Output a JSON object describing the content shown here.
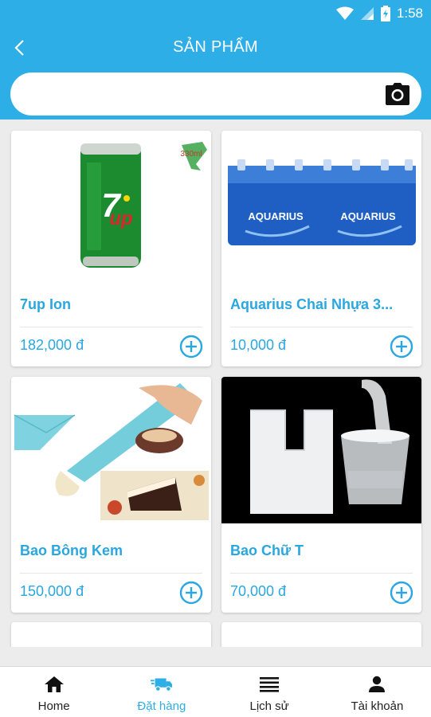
{
  "status_bar": {
    "time": "1:58",
    "icons": [
      "wifi-icon",
      "signal-icon",
      "battery-icon"
    ]
  },
  "header": {
    "title": "SẢN PHẨM",
    "back_icon": "chevron-left-icon"
  },
  "search": {
    "value": "",
    "placeholder": "",
    "camera_icon": "camera-icon"
  },
  "colors": {
    "primary": "#2daee6",
    "accent_text": "#2aa6e0",
    "background": "#ececec"
  },
  "products": [
    {
      "name": "7up Ion",
      "price": "182,000 đ",
      "image": "7up-can-image",
      "badge": "330ml"
    },
    {
      "name": "Aquarius Chai Nhựa 3...",
      "price": "10,000 đ",
      "image": "aquarius-bottle-pack-image",
      "brand": "AQUARIUS"
    },
    {
      "name": "Bao Bông Kem",
      "price": "150,000 đ",
      "image": "piping-bag-image"
    },
    {
      "name": "Bao Chữ T",
      "price": "70,000 đ",
      "image": "t-shirt-bag-image"
    }
  ],
  "bottom_nav": [
    {
      "label": "Home",
      "icon": "home-icon",
      "active": false
    },
    {
      "label": "Đặt hàng",
      "icon": "truck-icon",
      "active": true
    },
    {
      "label": "Lịch sử",
      "icon": "list-icon",
      "active": false
    },
    {
      "label": "Tài khoản",
      "icon": "user-icon",
      "active": false
    }
  ]
}
